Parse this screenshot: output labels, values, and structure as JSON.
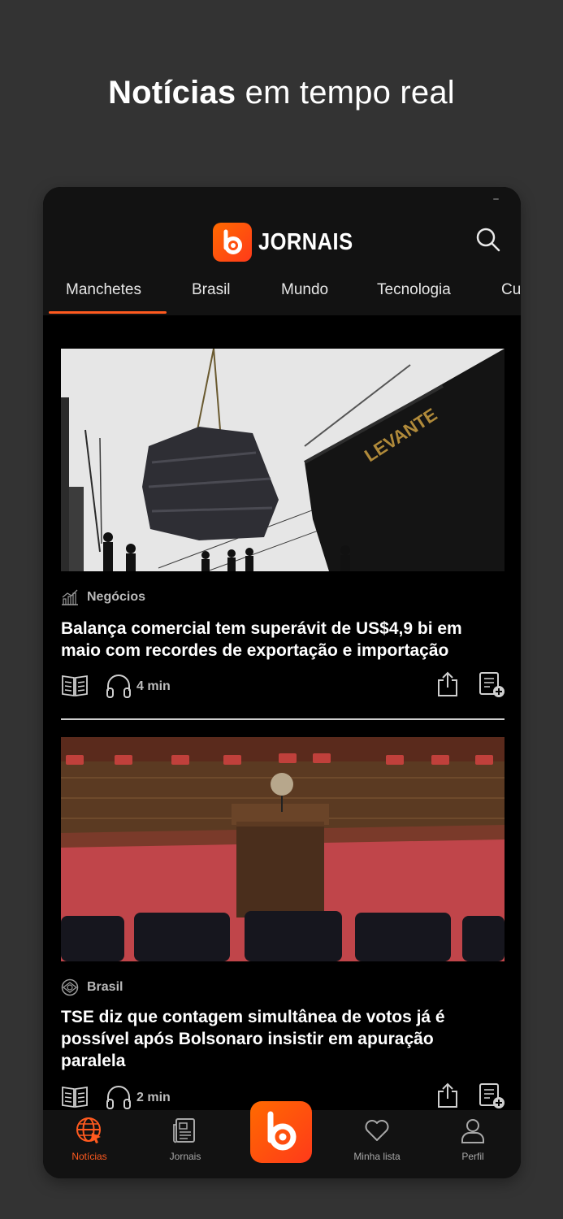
{
  "headline": {
    "strong": "Notícias",
    "rest": " em tempo real"
  },
  "app": {
    "name": "JORNAIS",
    "accent": "#ff5a1f"
  },
  "tabs": [
    "Manchetes",
    "Brasil",
    "Mundo",
    "Tecnologia",
    "Cu"
  ],
  "active_tab": "Manchetes",
  "articles": [
    {
      "category": "Negócios",
      "category_icon": "chart-icon",
      "title": "Balança comercial tem superávit de US$4,9 bi em maio com recordes de exportação e importação",
      "duration": "4 min",
      "image_alt": "Sacos sendo içados por guindaste ao lado do navio LEVANTE",
      "ship_name": "LEVANTE"
    },
    {
      "category": "Brasil",
      "category_icon": "brasil-icon",
      "title": "TSE diz que contagem simultânea de votos já é possível após Bolsonaro insistir em apuração paralela",
      "duration": "2 min",
      "image_alt": "Plenário com púlpito e brasão"
    }
  ],
  "bottom_nav": [
    {
      "label": "Notícias",
      "icon": "globe-icon",
      "active": true
    },
    {
      "label": "Jornais",
      "icon": "newspaper-icon",
      "active": false
    },
    {
      "label": "",
      "icon": "app-logo-icon",
      "active": false
    },
    {
      "label": "Minha lista",
      "icon": "heart-icon",
      "active": false
    },
    {
      "label": "Perfil",
      "icon": "user-icon",
      "active": false
    }
  ]
}
